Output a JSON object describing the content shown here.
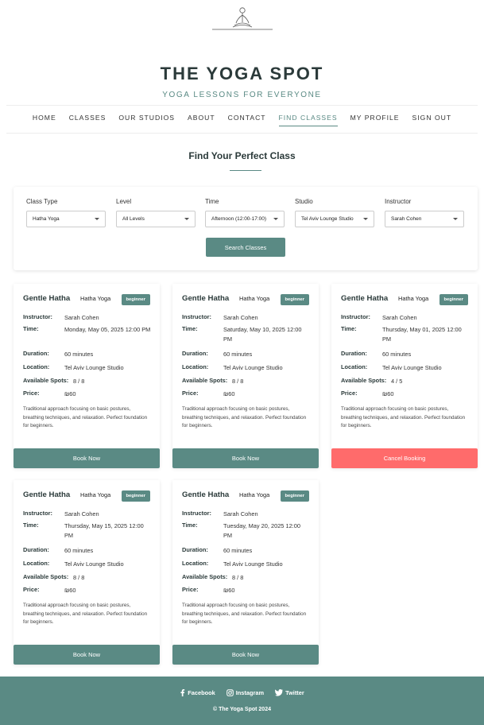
{
  "brand": {
    "title": "THE YOGA SPOT",
    "subtitle": "YOGA LESSONS FOR EVERYONE",
    "logo_icon": "meditation-figure-icon"
  },
  "nav": {
    "items": [
      "HOME",
      "CLASSES",
      "OUR STUDIOS",
      "ABOUT",
      "CONTACT",
      "FIND CLASSES",
      "MY PROFILE",
      "SIGN OUT"
    ],
    "active": "FIND CLASSES"
  },
  "find": {
    "title": "Find Your Perfect Class",
    "filters": [
      {
        "label": "Class Type",
        "value": "Hatha Yoga"
      },
      {
        "label": "Level",
        "value": "All Levels"
      },
      {
        "label": "Time",
        "value": "Afternoon (12:00-17:00)"
      },
      {
        "label": "Studio",
        "value": "Tel Aviv Lounge Studio"
      },
      {
        "label": "Instructor",
        "value": "Sarah Cohen"
      }
    ],
    "search_label": "Search Classes"
  },
  "labels": {
    "instructor": "Instructor:",
    "time": "Time:",
    "duration": "Duration:",
    "location": "Location:",
    "spots": "Available Spots:",
    "price": "Price:"
  },
  "classes": [
    {
      "name": "Gentle Hatha",
      "type": "Hatha Yoga",
      "level": "beginner",
      "instructor": "Sarah Cohen",
      "time": "Monday, May 05, 2025 12:00 PM",
      "duration": "60 minutes",
      "location": "Tel Aviv Lounge Studio",
      "spots": "8 / 8",
      "price": "₪60",
      "description": "Traditional approach focusing on basic postures, breathing techniques, and relaxation. Perfect foundation for beginners.",
      "action": "Book Now"
    },
    {
      "name": "Gentle Hatha",
      "type": "Hatha Yoga",
      "level": "beginner",
      "instructor": "Sarah Cohen",
      "time": "Saturday, May 10, 2025 12:00 PM",
      "duration": "60 minutes",
      "location": "Tel Aviv Lounge Studio",
      "spots": "8 / 8",
      "price": "₪60",
      "description": "Traditional approach focusing on basic postures, breathing techniques, and relaxation. Perfect foundation for beginners.",
      "action": "Book Now"
    },
    {
      "name": "Gentle Hatha",
      "type": "Hatha Yoga",
      "level": "beginner",
      "instructor": "Sarah Cohen",
      "time": "Thursday, May 01, 2025 12:00 PM",
      "duration": "60 minutes",
      "location": "Tel Aviv Lounge Studio",
      "spots": "4 / 5",
      "price": "₪60",
      "description": "Traditional approach focusing on basic postures, breathing techniques, and relaxation. Perfect foundation for beginners.",
      "action": "Cancel Booking"
    },
    {
      "name": "Gentle Hatha",
      "type": "Hatha Yoga",
      "level": "beginner",
      "instructor": "Sarah Cohen",
      "time": "Thursday, May 15, 2025 12:00 PM",
      "duration": "60 minutes",
      "location": "Tel Aviv Lounge Studio",
      "spots": "8 / 8",
      "price": "₪60",
      "description": "Traditional approach focusing on basic postures, breathing techniques, and relaxation. Perfect foundation for beginners.",
      "action": "Book Now"
    },
    {
      "name": "Gentle Hatha",
      "type": "Hatha Yoga",
      "level": "beginner",
      "instructor": "Sarah Cohen",
      "time": "Tuesday, May 20, 2025 12:00 PM",
      "duration": "60 minutes",
      "location": "Tel Aviv Lounge Studio",
      "spots": "8 / 8",
      "price": "₪60",
      "description": "Traditional approach focusing on basic postures, breathing techniques, and relaxation. Perfect foundation for beginners.",
      "action": "Book Now"
    }
  ],
  "footer": {
    "social": [
      {
        "label": "Facebook",
        "icon": "facebook-icon"
      },
      {
        "label": "Instagram",
        "icon": "instagram-icon"
      },
      {
        "label": "Twitter",
        "icon": "twitter-icon"
      }
    ],
    "copyright": "© The Yoga Spot 2024"
  },
  "colors": {
    "accent": "#5a8a84",
    "cancel": "#ff6b6b",
    "heading": "#2b3a3a"
  }
}
